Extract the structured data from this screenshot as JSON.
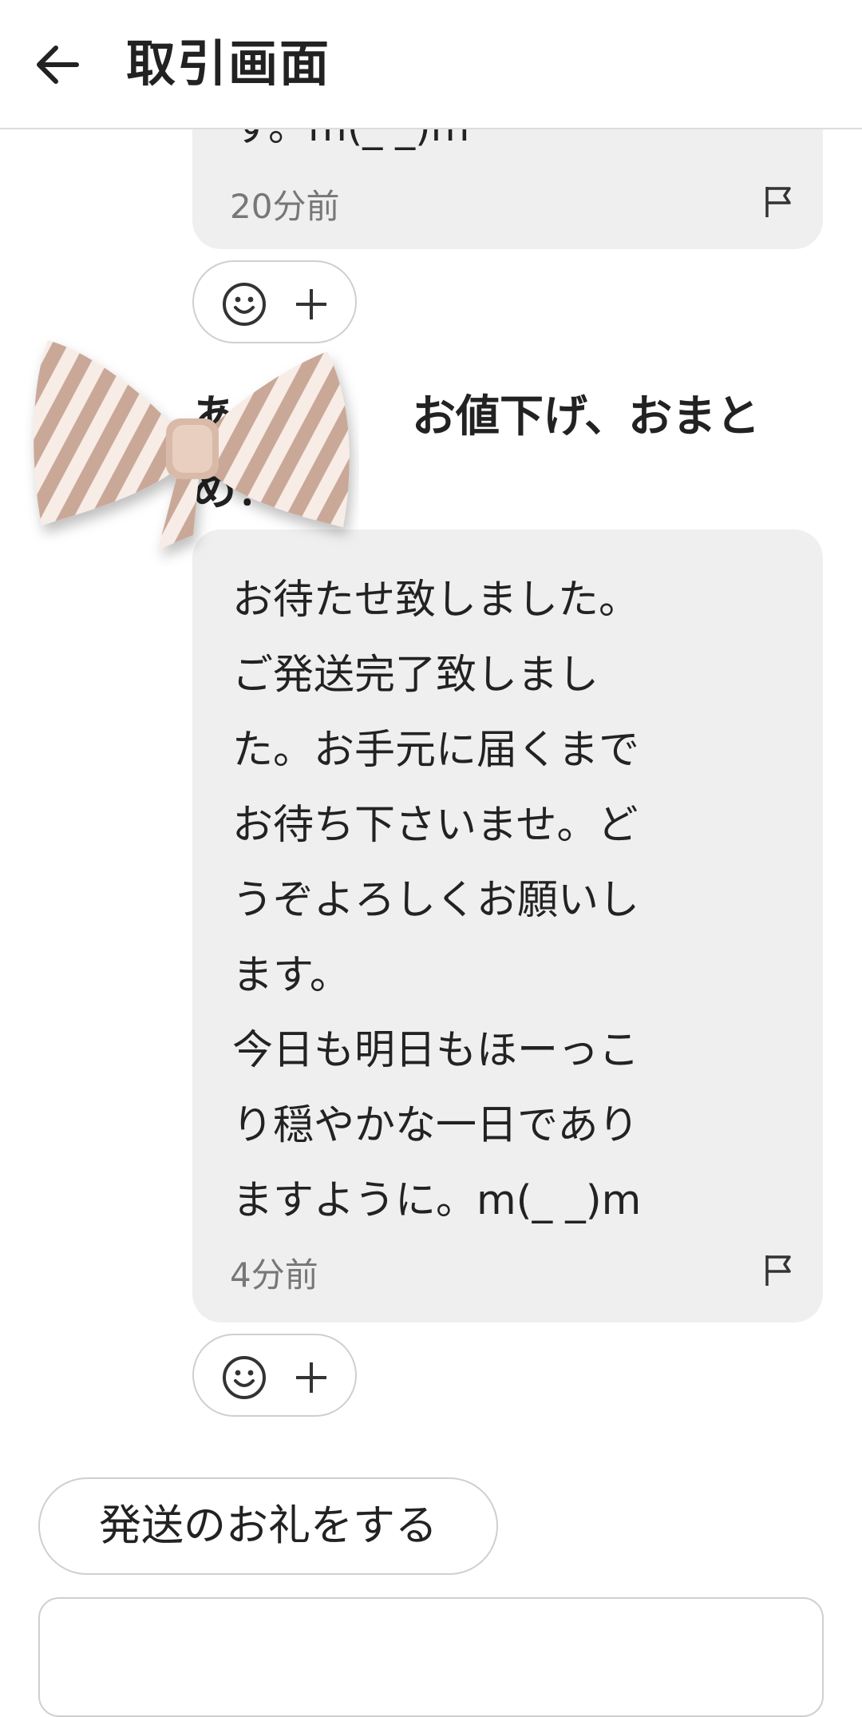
{
  "header": {
    "title": "取引画面"
  },
  "messages": [
    {
      "partial_text": "す。m(_ _)m",
      "time": "20分前"
    },
    {
      "sender": "あ　　　　お値下げ、おまとめ！",
      "text": "お待たせ致しました。\nご発送完了致しまし\nた。お手元に届くまで\nお待ち下さいませ。ど\nうぞよろしくお願いし\nます。\n今日も明日もほーっこ\nり穏やかな一日であり\nますように。m(_ _)m",
      "time": "4分前"
    }
  ],
  "actions": {
    "thanks_button": "発送のお礼をする"
  },
  "icons": {
    "back": "arrow-left-icon",
    "report": "flag-icon",
    "reaction": "smiley-icon",
    "add": "plus-icon"
  },
  "colors": {
    "bubble": "#efefef",
    "border": "#cfcfcf",
    "text": "#222222",
    "muted": "#777777"
  }
}
